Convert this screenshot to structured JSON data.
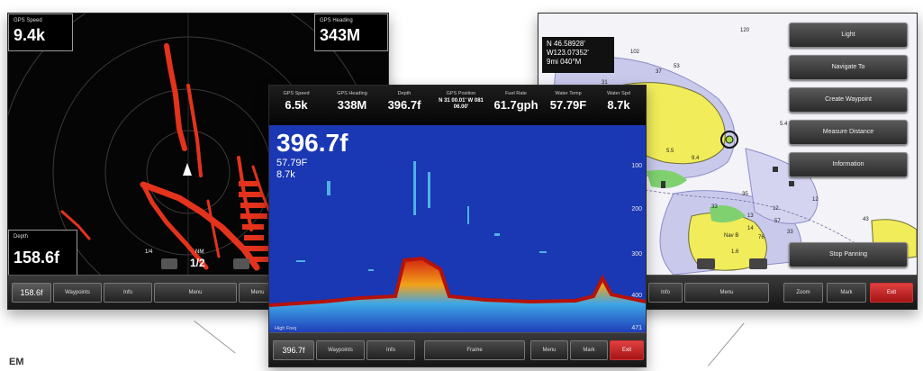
{
  "radar": {
    "gps_speed_label": "GPS Speed",
    "gps_speed_value": "9.4k",
    "gps_heading_label": "GPS Heading",
    "gps_heading_value": "343M",
    "depth_label": "Depth",
    "depth_value": "158.6f",
    "range_small": "1/4",
    "range_label": "NM",
    "range_value": "1/2",
    "softkeys": [
      "158.6f",
      "Waypoints",
      "Info",
      "Menu",
      "Menu"
    ]
  },
  "sonar": {
    "header": [
      {
        "label": "GPS Speed",
        "value": "6.5k"
      },
      {
        "label": "GPS Heading",
        "value": "338M"
      },
      {
        "label": "Depth",
        "value": "396.7f"
      },
      {
        "label": "GPS Position",
        "value": "N 31 00.01' W 081 06.00'"
      },
      {
        "label": "Fuel Rate",
        "value": "61.7gph"
      },
      {
        "label": "Water Temp",
        "value": "57.79F"
      },
      {
        "label": "Water Spd",
        "value": "8.7k"
      }
    ],
    "big_depth": "396.7f",
    "sub_temp": "57.79F",
    "sub_speed": "8.7k",
    "scale": [
      "100",
      "200",
      "300",
      "400",
      "471"
    ],
    "freq_label": "High Freq",
    "softkeys": [
      "396.7f",
      "Waypoints",
      "Info",
      "Frame",
      "Menu",
      "Mark",
      "Exit"
    ]
  },
  "chart": {
    "pos_line1": "N 46.58928'",
    "pos_line2": "W123.07352'",
    "pos_line3": "9mi   040°M",
    "menu": [
      "Light",
      "Navigate To",
      "Create Waypoint",
      "Measure Distance",
      "Information"
    ],
    "stop_button": "Stop Panning",
    "softkeys": [
      "Info",
      "Menu",
      "Zoom",
      "Mark",
      "Exit"
    ],
    "soundings": [
      "45",
      "102",
      "120",
      "52",
      "37",
      "53",
      "31",
      "5.4",
      "5.5",
      "44",
      "9.4",
      "34",
      "35",
      "33",
      "57",
      "76",
      "13",
      "14",
      "12",
      "1.6",
      "33",
      "43",
      "12"
    ],
    "nav_label": "Nav B"
  },
  "footer_text": "EM"
}
